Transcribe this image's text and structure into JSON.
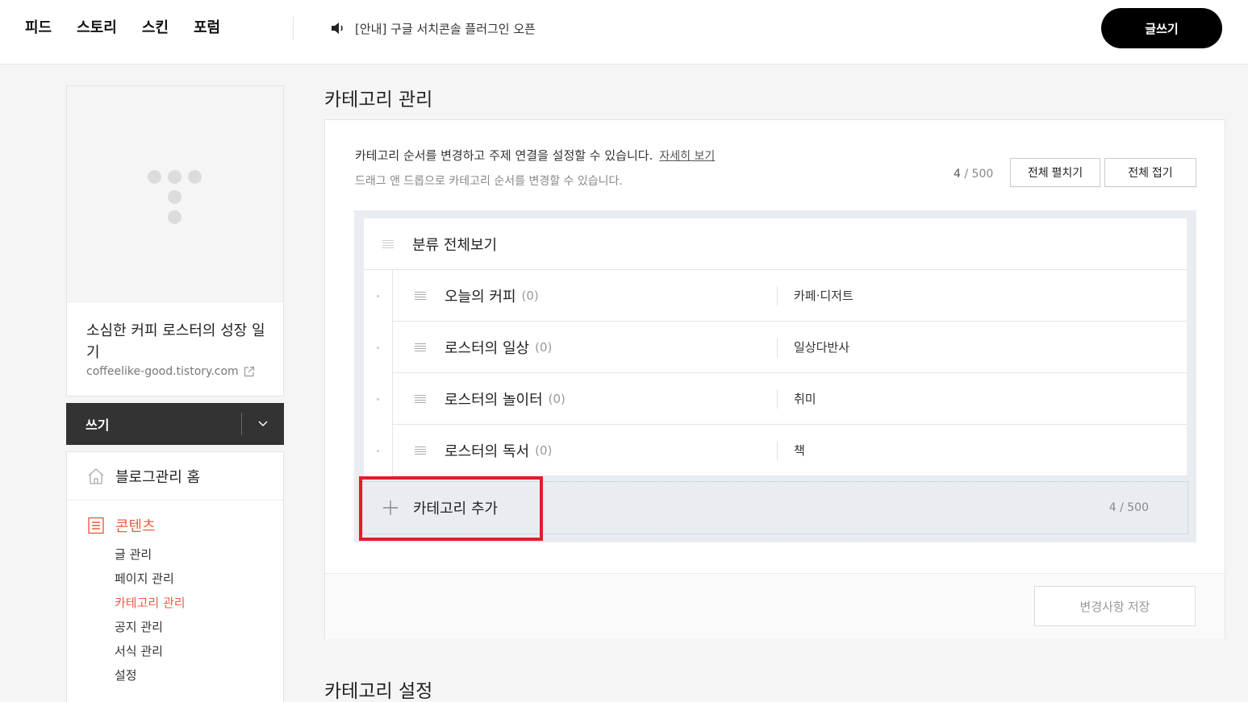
{
  "header": {
    "nav": [
      "피드",
      "스토리",
      "스킨",
      "포럼"
    ],
    "notice": "[안내] 구글 서치콘솔 플러그인 오픈",
    "write_button": "글쓰기"
  },
  "sidebar": {
    "blog_name": "소심한 커피 로스터의 성장 일기",
    "blog_url": "coffeelike-good.tistory.com",
    "write_label": "쓰기",
    "home_label": "블로그관리 홈",
    "section_label": "콘텐츠",
    "submenu": [
      "글 관리",
      "페이지 관리",
      "카테고리 관리",
      "공지 관리",
      "서식 관리",
      "설정"
    ],
    "active_index": 2
  },
  "main": {
    "title": "카테고리 관리",
    "desc1": "카테고리 순서를 변경하고 주제 연결을 설정할 수 있습니다.",
    "more_link": "자세히 보기",
    "desc2": "드래그 앤 드롭으로 카테고리 순서를 변경할 수 있습니다.",
    "count_current": "4",
    "count_max": " / 500",
    "expand_all": "전체 펼치기",
    "collapse_all": "전체 접기",
    "all_view": "분류 전체보기",
    "categories": [
      {
        "name": "오늘의 커피",
        "count": "(0)",
        "topic": "카페·디저트"
      },
      {
        "name": "로스터의 일상",
        "count": "(0)",
        "topic": "일상다반사"
      },
      {
        "name": "로스터의 놀이터",
        "count": "(0)",
        "topic": "취미"
      },
      {
        "name": "로스터의 독서",
        "count": "(0)",
        "topic": "책"
      }
    ],
    "add_category": "카테고리 추가",
    "add_count": "4 / 500",
    "save_button": "변경사항 저장",
    "second_title": "카테고리 설정"
  },
  "colors": {
    "accent": "#ef5a45",
    "highlight_box": "#e11d2a",
    "write_bar": "#333333"
  },
  "icons": [
    "speaker-icon",
    "external-link-icon",
    "chevron-down-icon",
    "home-icon",
    "document-icon",
    "drag-handle-icon",
    "plus-icon"
  ]
}
